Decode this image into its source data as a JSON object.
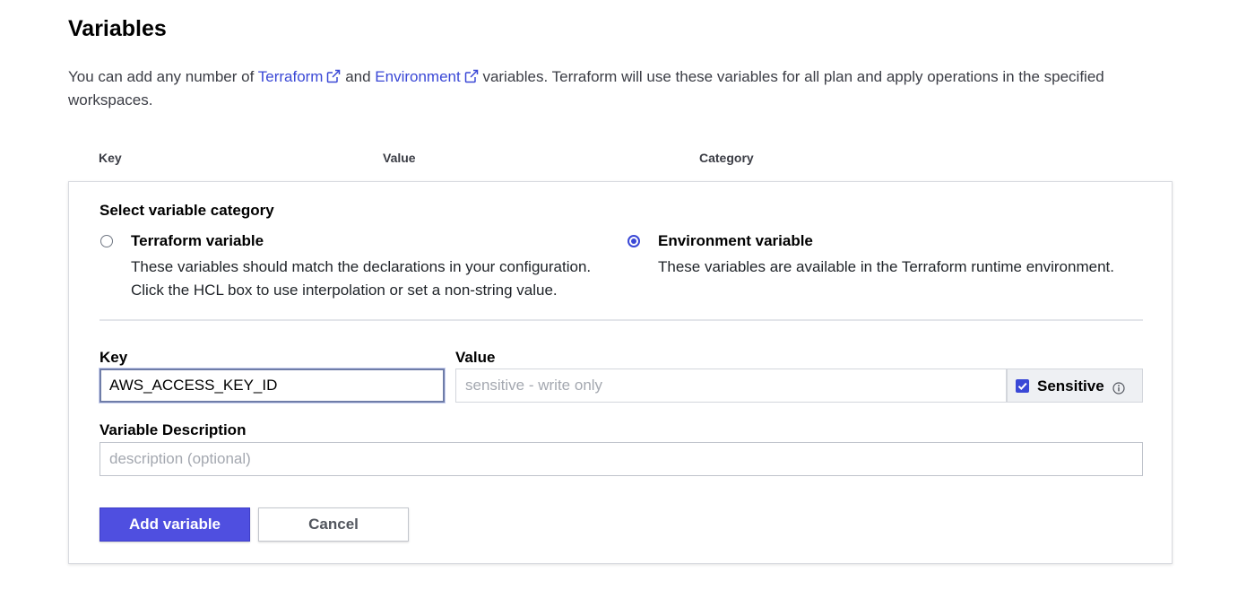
{
  "page": {
    "title": "Variables",
    "intro_prefix": "You can add any number of ",
    "link_terraform": "Terraform",
    "intro_and": " and ",
    "link_environment": "Environment",
    "intro_suffix": " variables. Terraform will use these variables for all plan and apply operations in the specified workspaces."
  },
  "columns": {
    "key": "Key",
    "value": "Value",
    "category": "Category"
  },
  "form": {
    "category_title": "Select variable category",
    "options": [
      {
        "label": "Terraform variable",
        "desc_line1": "These variables should match the declarations in your configuration.",
        "desc_line2": "Click the HCL box to use interpolation or set a non-string value.",
        "selected": false
      },
      {
        "label": "Environment variable",
        "desc_line1": "These variables are available in the Terraform runtime environment.",
        "desc_line2": "",
        "selected": true
      }
    ],
    "key_label": "Key",
    "key_value": "AWS_ACCESS_KEY_ID",
    "value_label": "Value",
    "value_placeholder": "sensitive - write only",
    "sensitive_label": "Sensitive",
    "sensitive_checked": true,
    "description_label": "Variable Description",
    "description_placeholder": "description (optional)",
    "add_button": "Add variable",
    "cancel_button": "Cancel"
  },
  "colors": {
    "accent": "#3a48d6",
    "primary_button": "#4f4fe0",
    "link": "#3a48d6"
  },
  "icons": {
    "external_link": "external-link-icon",
    "info": "info-icon",
    "check": "check-icon"
  }
}
